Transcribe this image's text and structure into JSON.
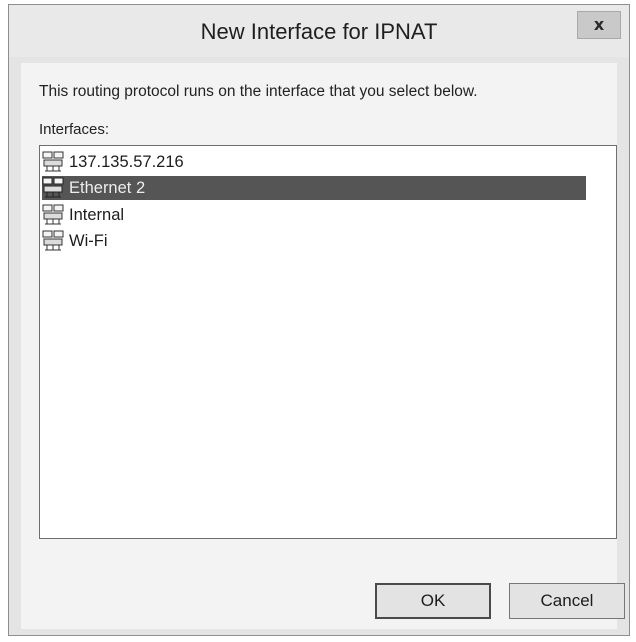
{
  "window": {
    "title": "New Interface for IPNAT",
    "close_label": "x"
  },
  "dialog": {
    "description": "This routing protocol runs on the interface that you select below.",
    "interfaces_label": "Interfaces:"
  },
  "interfaces": [
    {
      "label": "137.135.57.216",
      "icon": "network-adapter-icon",
      "selected": false
    },
    {
      "label": "Ethernet 2",
      "icon": "network-adapter-icon",
      "selected": true
    },
    {
      "label": "Internal",
      "icon": "network-adapter-icon",
      "selected": false
    },
    {
      "label": "Wi-Fi",
      "icon": "network-adapter-icon",
      "selected": false
    }
  ],
  "buttons": {
    "ok_label": "OK",
    "cancel_label": "Cancel"
  },
  "colors": {
    "selection_background": "#555555",
    "dialog_background": "#f3f3f3"
  }
}
